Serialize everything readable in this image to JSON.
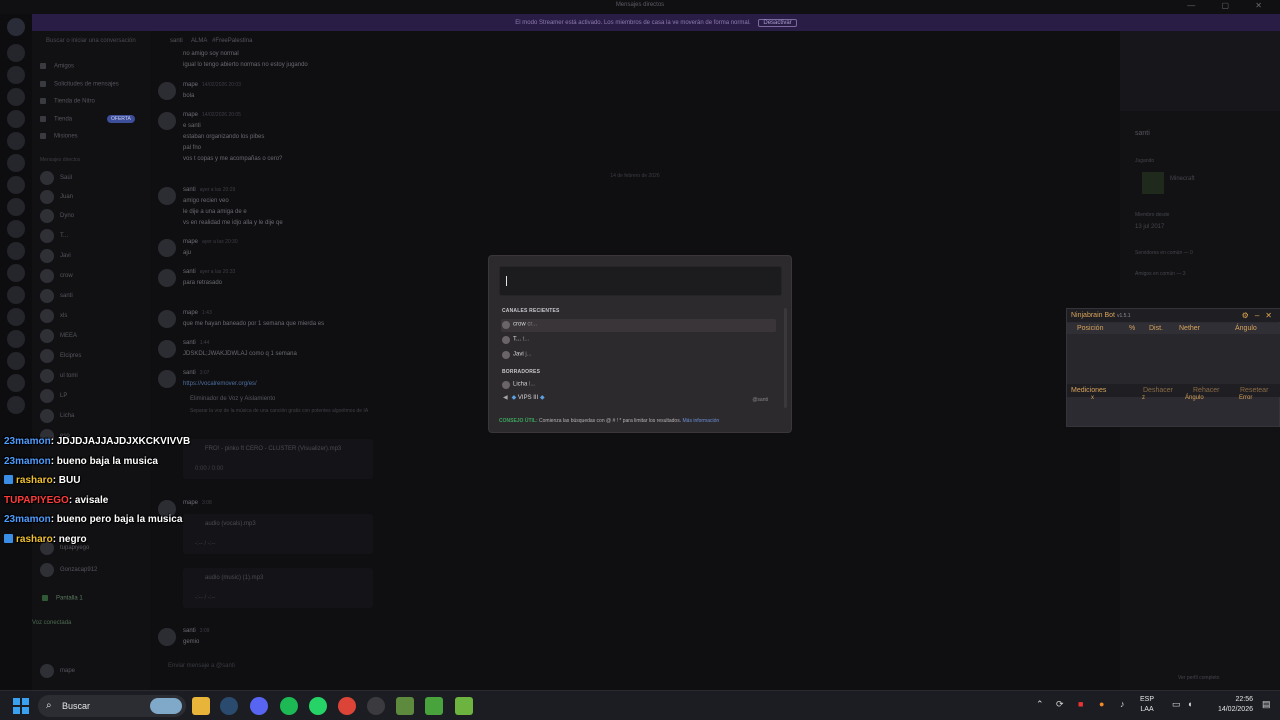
{
  "window": {
    "title": "Mensajes directos",
    "controls": "—  ▢  ✕"
  },
  "notice": {
    "text": "El modo Streamer está activado. Los miembros de casa la ve moverán de forma normal.",
    "button": "Desactivar"
  },
  "sidebar": {
    "search_placeholder": "Buscar o iniciar una conversación",
    "nav": [
      "Amigos",
      "Solicitudes de mensajes",
      "Tienda de Nitro",
      "Tienda",
      "Misiones"
    ],
    "shop_badge": "OFERTA",
    "section": "Mensajes directos",
    "dms": [
      "Saúl",
      "Juan",
      "Dyno",
      "T...",
      "Javi",
      "crow",
      "santi",
      "xls",
      "MEEA",
      "Elcipres",
      "ul tomi",
      "LP",
      "Licha",
      "eso",
      "tupapiyego",
      "Gonzacap912"
    ],
    "stream": "Pantalla 1",
    "voice": "Voz conectada",
    "user": "mape"
  },
  "chat": {
    "header": {
      "name": "santi",
      "status": "ALMA",
      "tag": "#FreePalestina"
    },
    "date_separator": "14 de febrero de 2026",
    "messages": [
      {
        "lines": [
          "no amigo soy normal",
          "igual lo tengo abierto normas no estoy jugando"
        ]
      },
      {
        "author": "mape",
        "badge": "bot",
        "time": "14/02/2026 20:03",
        "lines": [
          "bola"
        ]
      },
      {
        "author": "mape",
        "badge": "bot",
        "time": "14/02/2026 20:05",
        "lines": [
          "e santi",
          "estaban organizando los pibes",
          "pal fno",
          "vos t copas y me acompañas o cero?"
        ]
      },
      {
        "author": "santi",
        "time": "ayer a las 20:29",
        "lines": [
          "amigo recien veo",
          "le dije a una amiga de e",
          "vs en realidad me idjo alla y le dije qe"
        ]
      },
      {
        "author": "mape",
        "badge": "bot",
        "time": "ayer a las 20:30",
        "lines": [
          "aju"
        ]
      },
      {
        "author": "santi",
        "time": "ayer a las 20:33",
        "lines": [
          "para retrasado"
        ]
      },
      {
        "author": "mape",
        "badge": "bot",
        "time": "1:43",
        "lines": [
          "que me hayan baneado por 1 semana que mierda es"
        ]
      },
      {
        "author": "santi",
        "time": "1:44",
        "lines": [
          "JDSKDL;JWAKJDWLAJ como q 1 semana"
        ]
      },
      {
        "author": "santi",
        "time": "3:07",
        "lines": [
          "https://vocalremover.org/es/",
          "Eliminador de Voz y Aislamiento",
          "Separar la voz de la música de una canción gratis con potentes algoritmos de IA"
        ]
      },
      {
        "author": "mape",
        "badge": "bot",
        "time": "3:08",
        "lines": []
      },
      {
        "author": "santi",
        "time": "3:09",
        "lines": [
          "gemio"
        ]
      }
    ],
    "attachments": [
      {
        "file": "FRO! - pinko ft CERO - CLUSTER (Visualizer).mp3",
        "player": "0:00 / 0:00"
      },
      {
        "file": "audio (vocals).mp3",
        "player": "-:-- / -:--"
      },
      {
        "file": "audio (music) (1).mp3",
        "player": "-:-- / -:--"
      }
    ],
    "composer_placeholder": "Enviar mensaje a @santi"
  },
  "profile": {
    "name": "santi",
    "activity_label": "Jugando",
    "activity": "Minecraft",
    "member_since_label": "Miembro desde",
    "member_since": "13 jul 2017",
    "mutual_servers": "Servidores en común — 0",
    "mutual_friends": "Amigos en común — 3",
    "view_full": "Ver perfil completo"
  },
  "quickswitcher": {
    "input_value": "",
    "recent_label": "CANALES RECIENTES",
    "recent": [
      {
        "name": "crow",
        "hint": "cr..."
      },
      {
        "name": "T...",
        "hint": "t..."
      },
      {
        "name": "Javi",
        "hint": "j..."
      }
    ],
    "drafts_label": "BORRADORES",
    "drafts": [
      {
        "name": "Licha",
        "hint": "l..."
      },
      {
        "name": "VIPS III",
        "hint": "",
        "tag": "@santi"
      }
    ],
    "tip_label": "CONSEJO ÚTIL:",
    "tip": "Comienza las búsquedas con @ # ! * para limitar los resultados.",
    "tip_link": "Más información"
  },
  "ninjabrain": {
    "title": "Ninjabrain Bot",
    "version": "v1.5.1",
    "columns": [
      "Posición",
      "%",
      "Dist.",
      "Nether",
      "Ángulo"
    ],
    "measure_label": "Mediciones",
    "actions": [
      "Deshacer",
      "Rehacer",
      "Resetear"
    ],
    "measure_cols": [
      "x",
      "z",
      "Ángulo",
      "Error"
    ]
  },
  "overlay": [
    {
      "user": "23mamon",
      "color": "#4f9cff",
      "text": ": JDJDJAJJAJDJXKCKVIVVB",
      "twitch": false
    },
    {
      "user": "23mamon",
      "color": "#4f9cff",
      "text": ": bueno baja la musica",
      "twitch": false
    },
    {
      "user": "rasharo",
      "color": "#f0c030",
      "text": ": BUU",
      "twitch": true
    },
    {
      "user": "TUPAPIYEGO",
      "color": "#ff3b3b",
      "text": ": avisale",
      "twitch": false
    },
    {
      "user": "23mamon",
      "color": "#4f9cff",
      "text": ": bueno pero baja la musica",
      "twitch": false
    },
    {
      "user": "rasharo",
      "color": "#f0c030",
      "text": ": negro",
      "twitch": true
    }
  ],
  "taskbar": {
    "search": "Buscar",
    "lang": "ESP",
    "lang_sub": "LAA",
    "time": "22:56",
    "date": "14/02/2026",
    "apps": [
      "explorer-icon",
      "steam-icon",
      "discord-icon",
      "spotify-icon",
      "whatsapp-icon",
      "chrome-icon",
      "obs-icon",
      "minecraft-launcher-icon",
      "ninjabrain-icon",
      "minecraft-icon"
    ]
  }
}
